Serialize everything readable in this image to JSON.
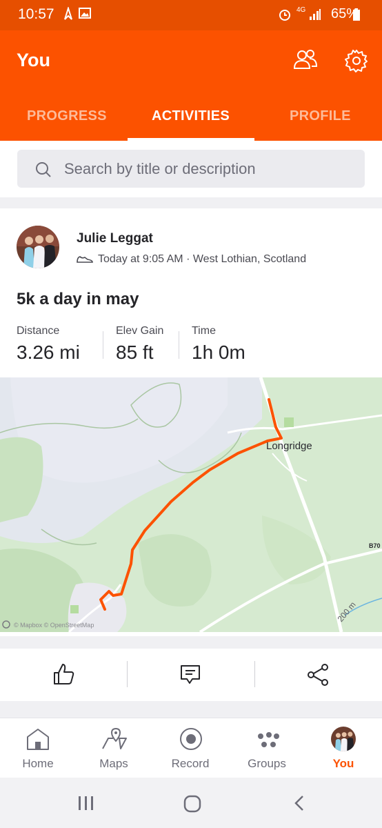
{
  "status_bar": {
    "time": "10:57",
    "network": "4G",
    "battery": "65%"
  },
  "header": {
    "title": "You"
  },
  "tabs": [
    {
      "label": "PROGRESS",
      "active": false
    },
    {
      "label": "ACTIVITIES",
      "active": true
    },
    {
      "label": "PROFILE",
      "active": false
    }
  ],
  "search": {
    "placeholder": "Search by title or description"
  },
  "activity": {
    "athlete": "Julie Leggat",
    "meta": "Today at 9:05 AM · West Lothian, Scotland",
    "title": "5k a day in may",
    "stats": [
      {
        "label": "Distance",
        "value": "3.26 mi"
      },
      {
        "label": "Elev Gain",
        "value": "85 ft"
      },
      {
        "label": "Time",
        "value": "1h 0m"
      }
    ],
    "map": {
      "place_label": "Longridge",
      "road_label": "B70",
      "scale_label": "200 m",
      "attribution": "© Mapbox © OpenStreetMap"
    }
  },
  "bottom_nav": [
    {
      "label": "Home",
      "icon": "home-icon",
      "active": false
    },
    {
      "label": "Maps",
      "icon": "maps-icon",
      "active": false
    },
    {
      "label": "Record",
      "icon": "record-icon",
      "active": false
    },
    {
      "label": "Groups",
      "icon": "groups-icon",
      "active": false
    },
    {
      "label": "You",
      "icon": "avatar",
      "active": true
    }
  ],
  "colors": {
    "brand": "#fc5200",
    "status_bar": "#e64f00",
    "route": "#fc5200"
  }
}
